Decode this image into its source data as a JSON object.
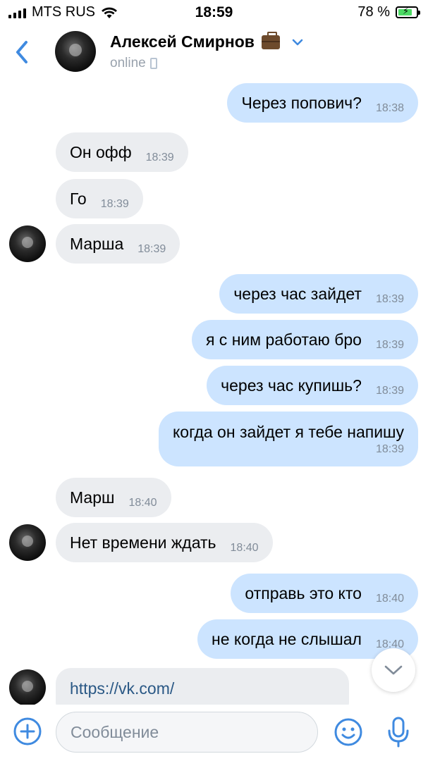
{
  "status_bar": {
    "carrier": "MTS RUS",
    "time": "18:59",
    "battery": "78 %",
    "battery_level": 0.78
  },
  "header": {
    "back_icon": "chevron-left-icon",
    "name": "Алексей Смирнов",
    "name_emoji": "briefcase-icon",
    "dropdown_icon": "chevron-down-icon",
    "status": "online",
    "status_icon": "mobile-phone-icon"
  },
  "messages": [
    {
      "dir": "out",
      "text": "Через попович?",
      "time": "18:38"
    },
    {
      "dir": "in",
      "text": "Он офф",
      "time": "18:39"
    },
    {
      "dir": "in",
      "text": "Го",
      "time": "18:39"
    },
    {
      "dir": "in",
      "text": "Марша",
      "time": "18:39"
    },
    {
      "dir": "out",
      "text": "через час зайдет",
      "time": "18:39"
    },
    {
      "dir": "out",
      "text": "я с ним работаю бро",
      "time": "18:39"
    },
    {
      "dir": "out",
      "text": "через час купишь?",
      "time": "18:39"
    },
    {
      "dir": "out",
      "text": "когда он зайдет я тебе напишу",
      "time": "18:39"
    },
    {
      "dir": "in",
      "text": "Марш",
      "time": "18:40"
    },
    {
      "dir": "in",
      "text": "Нет времени ждать",
      "time": "18:40"
    },
    {
      "dir": "out",
      "text": "отправь это кто",
      "time": "18:40"
    },
    {
      "dir": "out",
      "text": "не когда не слышал",
      "time": "18:40"
    },
    {
      "dir": "in",
      "text": "https://vk.com/",
      "time": ""
    }
  ],
  "composer": {
    "placeholder": "Сообщение",
    "add_icon": "plus-circle-icon",
    "emoji_icon": "smiley-icon",
    "mic_icon": "microphone-icon",
    "scroll_icon": "chevron-down-icon"
  },
  "colors": {
    "accent": "#3f8ae0",
    "incoming_bubble": "#ebedf0",
    "outgoing_bubble": "#cce4ff",
    "time_text": "#818c99",
    "link": "#2a5885"
  }
}
